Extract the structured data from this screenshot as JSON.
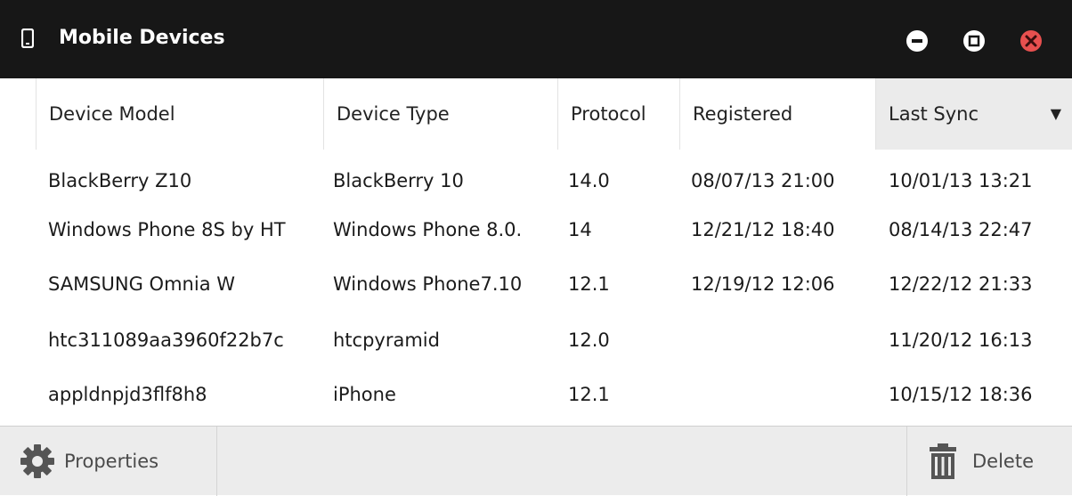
{
  "window": {
    "title": "Mobile Devices",
    "title_icon": "mobile-phone-icon",
    "controls": [
      "minimize-icon",
      "maximize-icon",
      "close-icon"
    ],
    "close_color": "#e8504f"
  },
  "table": {
    "columns": [
      {
        "label": "Device Model"
      },
      {
        "label": "Device Type"
      },
      {
        "label": "Protocol"
      },
      {
        "label": "Registered"
      },
      {
        "label": "Last Sync",
        "sorted": "descending"
      }
    ],
    "sort_indicator": "▼",
    "rows": [
      {
        "model": "BlackBerry Z10",
        "type": "BlackBerry 10",
        "protocol": "14.0",
        "registered": "08/07/13 21:00",
        "last_sync": "10/01/13 13:21"
      },
      {
        "model": "Windows Phone 8S by HT",
        "type": "Windows Phone 8.0.",
        "protocol": "14",
        "registered": "12/21/12 18:40",
        "last_sync": "08/14/13 22:47"
      },
      {
        "model": "SAMSUNG Omnia W",
        "type": "Windows Phone7.10",
        "protocol": "12.1",
        "registered": "12/19/12 12:06",
        "last_sync": "12/22/12 21:33"
      },
      {
        "model": "htc311089aa3960f22b7c",
        "type": "htcpyramid",
        "protocol": "12.0",
        "registered": "",
        "last_sync": "11/20/12 16:13"
      },
      {
        "model": "appldnpjd3flf8h8",
        "type": "iPhone",
        "protocol": "12.1",
        "registered": "",
        "last_sync": "10/15/12 18:36"
      }
    ]
  },
  "toolbar": {
    "properties_label": "Properties",
    "properties_icon": "gear-icon",
    "delete_label": "Delete",
    "delete_icon": "trash-icon"
  }
}
